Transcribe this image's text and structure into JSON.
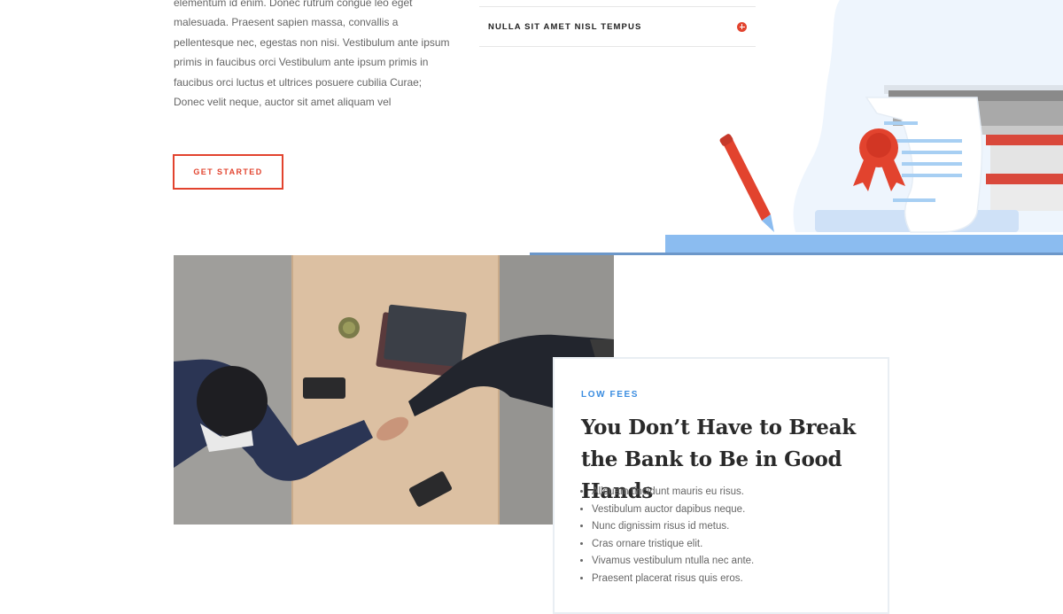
{
  "intro": {
    "lines": [
      "elementum id enim. Donec rutrum congue leo eget",
      "malesuada. Praesent sapien massa, convallis a",
      "pellentesque nec, egestas non nisi. Vestibulum ante ipsum",
      "primis in faucibus orci Vestibulum ante ipsum primis in",
      "faucibus orci luctus et ultrices posuere cubilia Curae;",
      "Donec velit neque, auctor sit amet aliquam vel"
    ],
    "button_label": "GET STARTED"
  },
  "accordion": {
    "item_title": "NULLA SIT AMET NISL TEMPUS"
  },
  "card": {
    "eyebrow": "LOW FEES",
    "title": "You Don’t Have to Break the Bank to Be in Good Hands",
    "bullets": [
      "Aliquam tincidunt mauris eu risus.",
      "Vestibulum auctor dapibus neque.",
      "Nunc dignissim risus id metus.",
      "Cras ornare tristique elit.",
      "Vivamus vestibulum ntulla nec ante.",
      "Praesent placerat risus quis eros."
    ]
  },
  "colors": {
    "accent_red": "#e2432e",
    "accent_blue": "#3b8de0",
    "illustration_blue": "#8bbcf0",
    "blob": "#eef5fd"
  },
  "icons": {
    "accordion_toggle": "plus-circle-icon"
  }
}
